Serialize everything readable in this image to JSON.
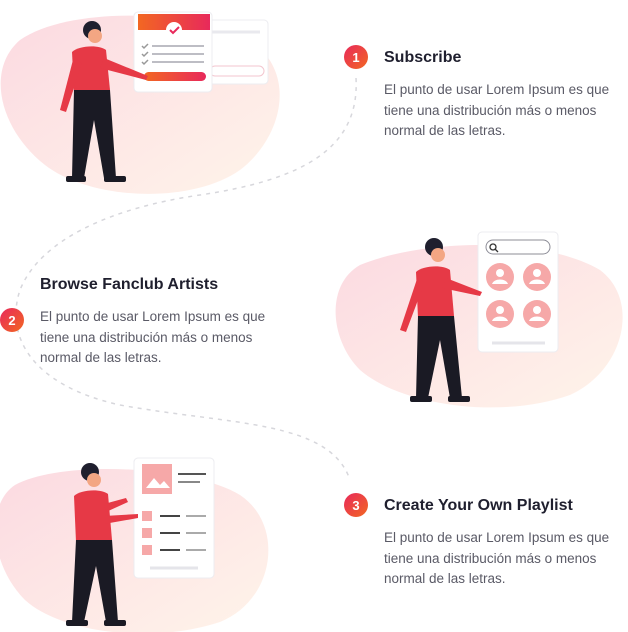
{
  "accent_colors": {
    "pink": "#e8295b",
    "orange": "#f26722",
    "blob": "#fde1e4",
    "avatar": "#f6a8a8",
    "dark": "#1f1f2e"
  },
  "steps": [
    {
      "number": "1",
      "title": "Subscribe",
      "description": "El punto de usar Lorem Ipsum es que tiene una distribución más o menos normal de las letras."
    },
    {
      "number": "2",
      "title": "Browse Fanclub Artists",
      "description": "El punto de usar Lorem Ipsum es que tiene una distribución más o menos normal de las letras."
    },
    {
      "number": "3",
      "title": "Create Your Own Playlist",
      "description": "El punto de usar Lorem Ipsum es que tiene una distribución más o menos normal de las letras."
    }
  ],
  "icons": [
    "checkmark-icon",
    "search-icon",
    "user-avatar-icon",
    "image-placeholder-icon"
  ]
}
